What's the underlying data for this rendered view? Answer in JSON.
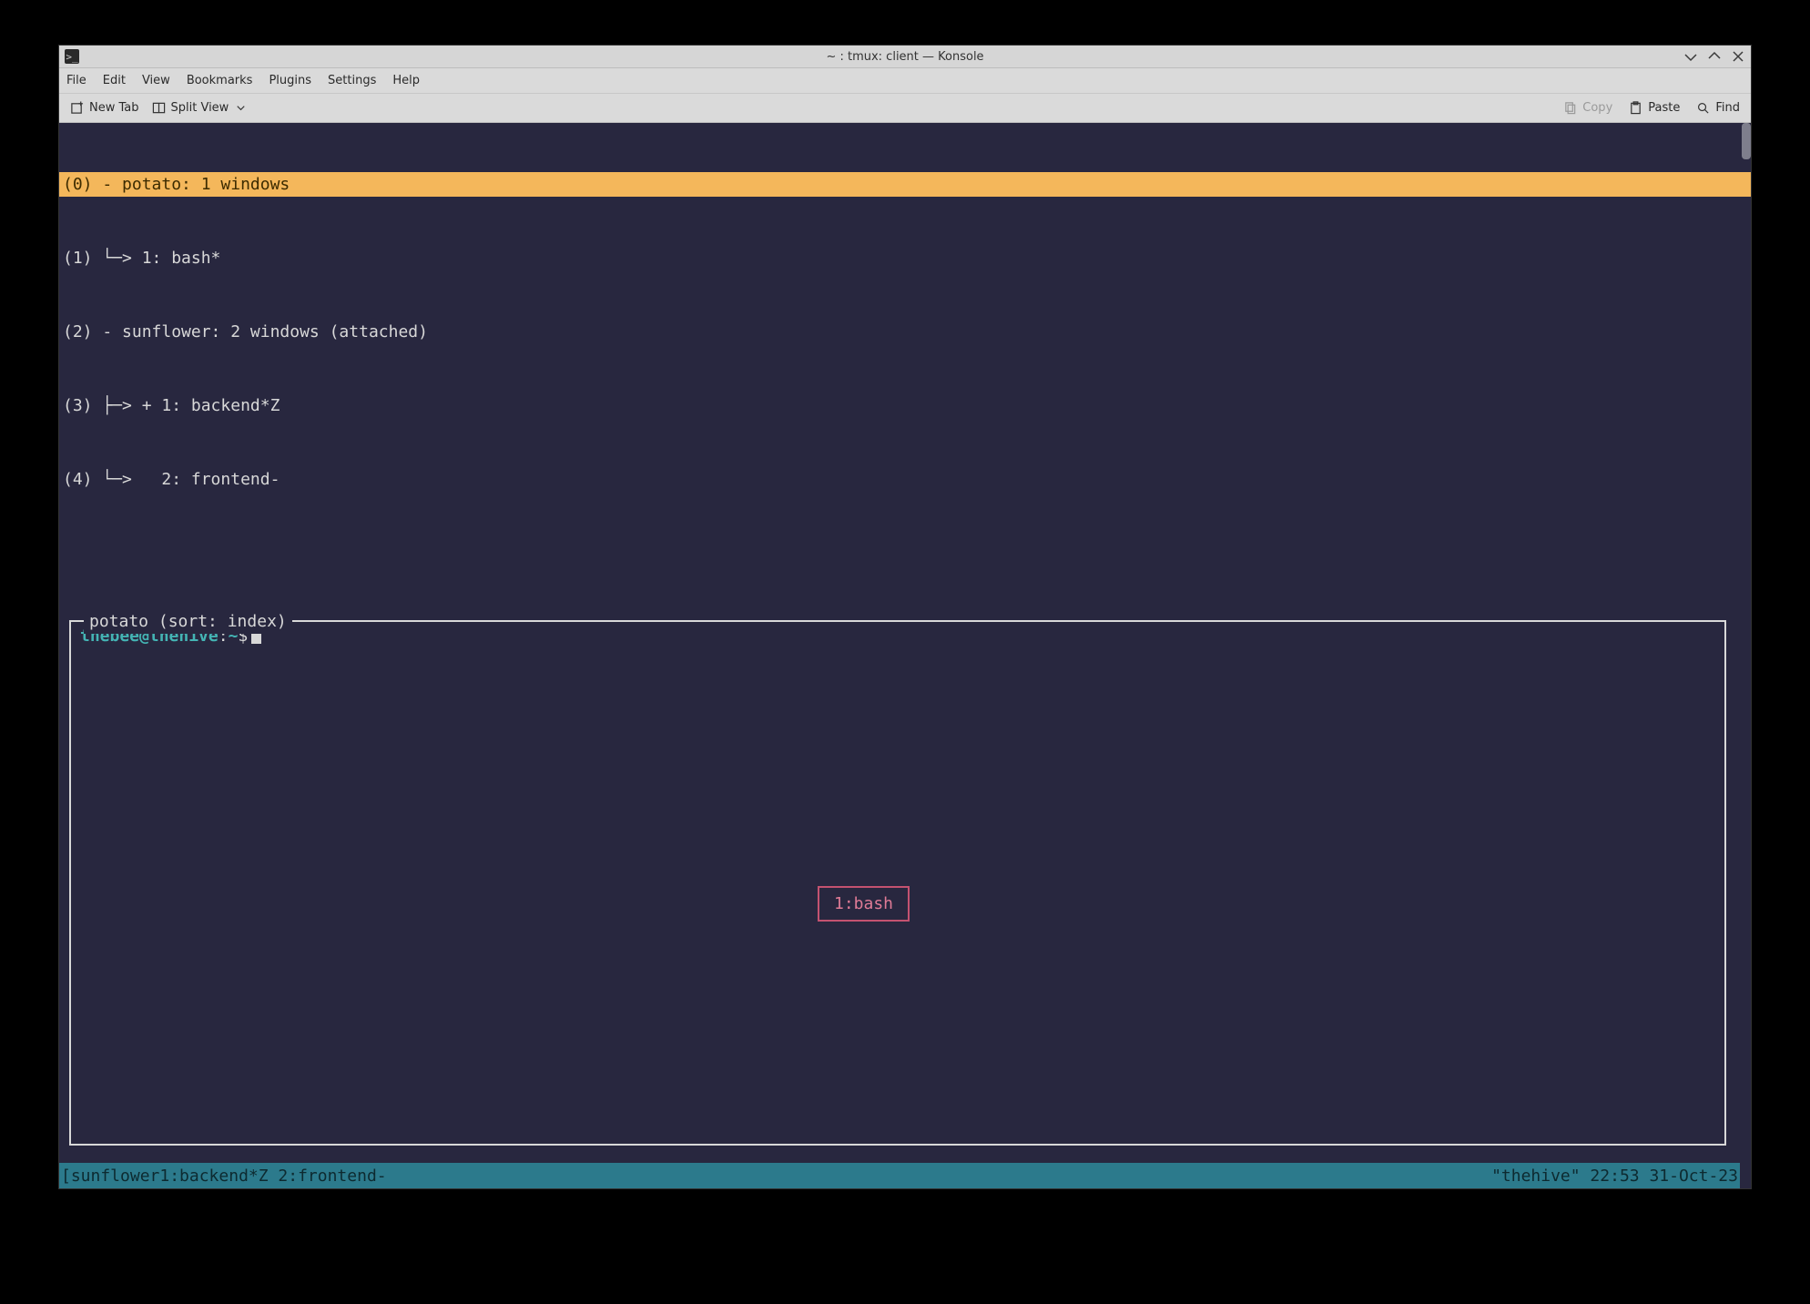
{
  "window": {
    "title": "~ : tmux: client — Konsole"
  },
  "menu": {
    "file": "File",
    "edit": "Edit",
    "view": "View",
    "bookmarks": "Bookmarks",
    "plugins": "Plugins",
    "settings": "Settings",
    "help": "Help"
  },
  "toolbar": {
    "new_tab": "New Tab",
    "split_view": "Split View",
    "copy": "Copy",
    "paste": "Paste",
    "find": "Find"
  },
  "tmux_tree": {
    "lines": [
      "(0) - potato: 1 windows",
      "(1) └─> 1: bash*",
      "(2) - sunflower: 2 windows (attached)",
      "(3) ├─> + 1: backend*Z",
      "(4) └─>   2: frontend-"
    ],
    "highlighted_index": 0
  },
  "preview": {
    "title": "potato (sort: index)",
    "prompt_user": "thebee@thehive",
    "prompt_sep": ":",
    "prompt_path": "~",
    "prompt_end": "$",
    "window_label": "1:bash"
  },
  "status": {
    "left": "[sunflower1:backend*Z 2:frontend-",
    "right": "\"thehive\" 22:53 31-Oct-23"
  }
}
